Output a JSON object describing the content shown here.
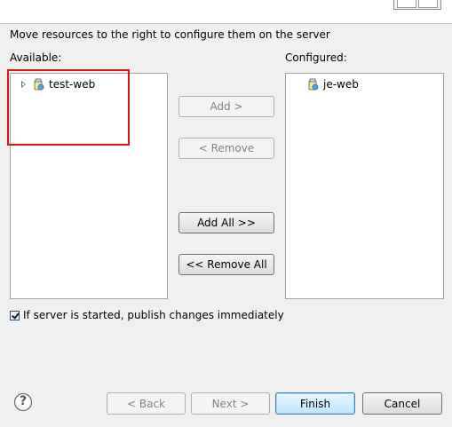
{
  "header": {
    "instruction": "Move resources to the right to configure them on the server"
  },
  "available": {
    "label": "Available:",
    "items": [
      {
        "label": "test-web"
      }
    ]
  },
  "configured": {
    "label": "Configured:",
    "items": [
      {
        "label": "je-web"
      }
    ]
  },
  "buttons": {
    "add": "Add >",
    "remove": "< Remove",
    "add_all": "Add All >>",
    "remove_all": "<< Remove All"
  },
  "publish_option": {
    "label": "If server is started, publish changes immediately",
    "checked": true
  },
  "footer": {
    "help_icon": "?",
    "back": "< Back",
    "next": "Next >",
    "finish": "Finish",
    "cancel": "Cancel"
  },
  "colors": {
    "highlight": "#e01414",
    "dialog_background": "#f0f0f0",
    "default_button_border": "#3c7fb1"
  }
}
